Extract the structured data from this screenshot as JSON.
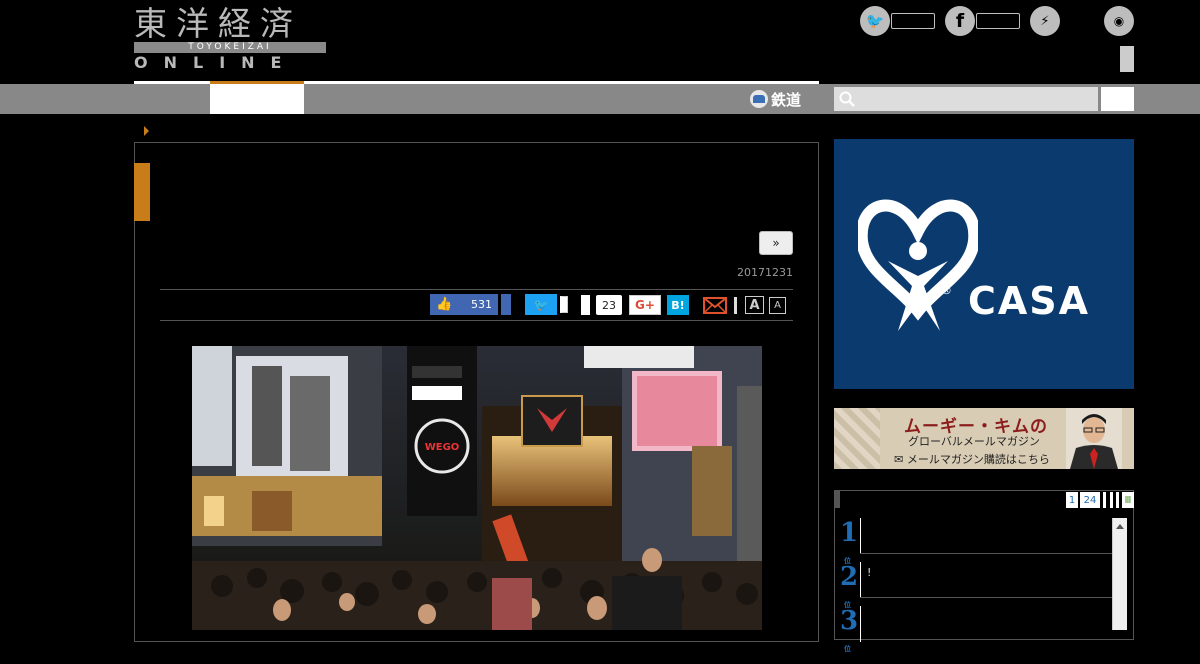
{
  "header": {
    "logo_kanji": "東洋経済",
    "logo_roman": "TOYOKEIZAI",
    "logo_sub": "ONLINE",
    "social": {
      "twitter_glyph": "🐦",
      "facebook_glyph": "f",
      "messenger_glyph": "⚡",
      "rss_glyph": "◉"
    }
  },
  "nav": {
    "rail_label": "鉄道",
    "search_placeholder": ""
  },
  "article": {
    "next_button": "»",
    "date": "20171231",
    "share": {
      "facebook_count": "531",
      "twitter_glyph": "🐦",
      "pocket_count": "23",
      "gplus_label": "G+",
      "hatena_label": "B!",
      "font_large": "A",
      "font_small": "A"
    }
  },
  "sidebar": {
    "ad_casa": {
      "brand": "CASA",
      "reg_mark": "®"
    },
    "ad_mogi": {
      "title": "ムーギー・キムの",
      "subtitle": "グローバルメールマガジン",
      "cta": "✉ メールマガジン購読はこちら"
    },
    "ranking": {
      "tabs": {
        "tab1": "1",
        "tab2": "24",
        "tab3": "Ⅲ"
      },
      "rows": [
        {
          "rank": "1",
          "unit": "位",
          "text": ""
        },
        {
          "rank": "2",
          "unit": "位",
          "text": "!"
        },
        {
          "rank": "3",
          "unit": "位",
          "text": ""
        }
      ]
    }
  },
  "colors": {
    "accent_orange": "#c97d1a",
    "nav_gray": "#888888",
    "facebook_blue": "#4267b2",
    "twitter_blue": "#1da1f2",
    "hatena_blue": "#00a4de",
    "casa_navy": "#0a3a6e",
    "rank_blue": "#1f6db5"
  }
}
